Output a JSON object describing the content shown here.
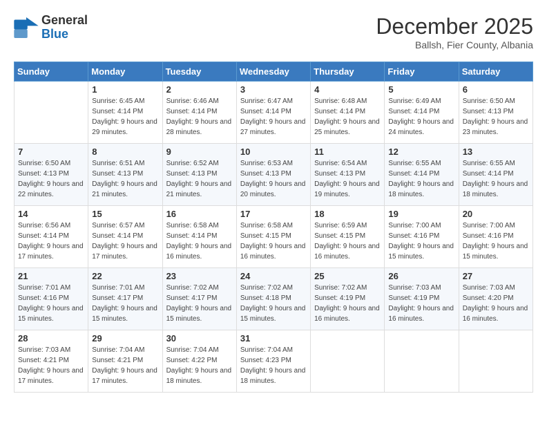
{
  "header": {
    "logo_general": "General",
    "logo_blue": "Blue",
    "month_title": "December 2025",
    "location": "Ballsh, Fier County, Albania"
  },
  "weekdays": [
    "Sunday",
    "Monday",
    "Tuesday",
    "Wednesday",
    "Thursday",
    "Friday",
    "Saturday"
  ],
  "weeks": [
    [
      {
        "day": "",
        "sunrise": "",
        "sunset": "",
        "daylight": ""
      },
      {
        "day": "1",
        "sunrise": "6:45 AM",
        "sunset": "4:14 PM",
        "daylight": "9 hours and 29 minutes."
      },
      {
        "day": "2",
        "sunrise": "6:46 AM",
        "sunset": "4:14 PM",
        "daylight": "9 hours and 28 minutes."
      },
      {
        "day": "3",
        "sunrise": "6:47 AM",
        "sunset": "4:14 PM",
        "daylight": "9 hours and 27 minutes."
      },
      {
        "day": "4",
        "sunrise": "6:48 AM",
        "sunset": "4:14 PM",
        "daylight": "9 hours and 25 minutes."
      },
      {
        "day": "5",
        "sunrise": "6:49 AM",
        "sunset": "4:14 PM",
        "daylight": "9 hours and 24 minutes."
      },
      {
        "day": "6",
        "sunrise": "6:50 AM",
        "sunset": "4:13 PM",
        "daylight": "9 hours and 23 minutes."
      }
    ],
    [
      {
        "day": "7",
        "sunrise": "6:50 AM",
        "sunset": "4:13 PM",
        "daylight": "9 hours and 22 minutes."
      },
      {
        "day": "8",
        "sunrise": "6:51 AM",
        "sunset": "4:13 PM",
        "daylight": "9 hours and 21 minutes."
      },
      {
        "day": "9",
        "sunrise": "6:52 AM",
        "sunset": "4:13 PM",
        "daylight": "9 hours and 21 minutes."
      },
      {
        "day": "10",
        "sunrise": "6:53 AM",
        "sunset": "4:13 PM",
        "daylight": "9 hours and 20 minutes."
      },
      {
        "day": "11",
        "sunrise": "6:54 AM",
        "sunset": "4:13 PM",
        "daylight": "9 hours and 19 minutes."
      },
      {
        "day": "12",
        "sunrise": "6:55 AM",
        "sunset": "4:14 PM",
        "daylight": "9 hours and 18 minutes."
      },
      {
        "day": "13",
        "sunrise": "6:55 AM",
        "sunset": "4:14 PM",
        "daylight": "9 hours and 18 minutes."
      }
    ],
    [
      {
        "day": "14",
        "sunrise": "6:56 AM",
        "sunset": "4:14 PM",
        "daylight": "9 hours and 17 minutes."
      },
      {
        "day": "15",
        "sunrise": "6:57 AM",
        "sunset": "4:14 PM",
        "daylight": "9 hours and 17 minutes."
      },
      {
        "day": "16",
        "sunrise": "6:58 AM",
        "sunset": "4:14 PM",
        "daylight": "9 hours and 16 minutes."
      },
      {
        "day": "17",
        "sunrise": "6:58 AM",
        "sunset": "4:15 PM",
        "daylight": "9 hours and 16 minutes."
      },
      {
        "day": "18",
        "sunrise": "6:59 AM",
        "sunset": "4:15 PM",
        "daylight": "9 hours and 16 minutes."
      },
      {
        "day": "19",
        "sunrise": "7:00 AM",
        "sunset": "4:16 PM",
        "daylight": "9 hours and 15 minutes."
      },
      {
        "day": "20",
        "sunrise": "7:00 AM",
        "sunset": "4:16 PM",
        "daylight": "9 hours and 15 minutes."
      }
    ],
    [
      {
        "day": "21",
        "sunrise": "7:01 AM",
        "sunset": "4:16 PM",
        "daylight": "9 hours and 15 minutes."
      },
      {
        "day": "22",
        "sunrise": "7:01 AM",
        "sunset": "4:17 PM",
        "daylight": "9 hours and 15 minutes."
      },
      {
        "day": "23",
        "sunrise": "7:02 AM",
        "sunset": "4:17 PM",
        "daylight": "9 hours and 15 minutes."
      },
      {
        "day": "24",
        "sunrise": "7:02 AM",
        "sunset": "4:18 PM",
        "daylight": "9 hours and 15 minutes."
      },
      {
        "day": "25",
        "sunrise": "7:02 AM",
        "sunset": "4:19 PM",
        "daylight": "9 hours and 16 minutes."
      },
      {
        "day": "26",
        "sunrise": "7:03 AM",
        "sunset": "4:19 PM",
        "daylight": "9 hours and 16 minutes."
      },
      {
        "day": "27",
        "sunrise": "7:03 AM",
        "sunset": "4:20 PM",
        "daylight": "9 hours and 16 minutes."
      }
    ],
    [
      {
        "day": "28",
        "sunrise": "7:03 AM",
        "sunset": "4:21 PM",
        "daylight": "9 hours and 17 minutes."
      },
      {
        "day": "29",
        "sunrise": "7:04 AM",
        "sunset": "4:21 PM",
        "daylight": "9 hours and 17 minutes."
      },
      {
        "day": "30",
        "sunrise": "7:04 AM",
        "sunset": "4:22 PM",
        "daylight": "9 hours and 18 minutes."
      },
      {
        "day": "31",
        "sunrise": "7:04 AM",
        "sunset": "4:23 PM",
        "daylight": "9 hours and 18 minutes."
      },
      {
        "day": "",
        "sunrise": "",
        "sunset": "",
        "daylight": ""
      },
      {
        "day": "",
        "sunrise": "",
        "sunset": "",
        "daylight": ""
      },
      {
        "day": "",
        "sunrise": "",
        "sunset": "",
        "daylight": ""
      }
    ]
  ],
  "labels": {
    "sunrise_prefix": "Sunrise: ",
    "sunset_prefix": "Sunset: ",
    "daylight_prefix": "Daylight: "
  }
}
